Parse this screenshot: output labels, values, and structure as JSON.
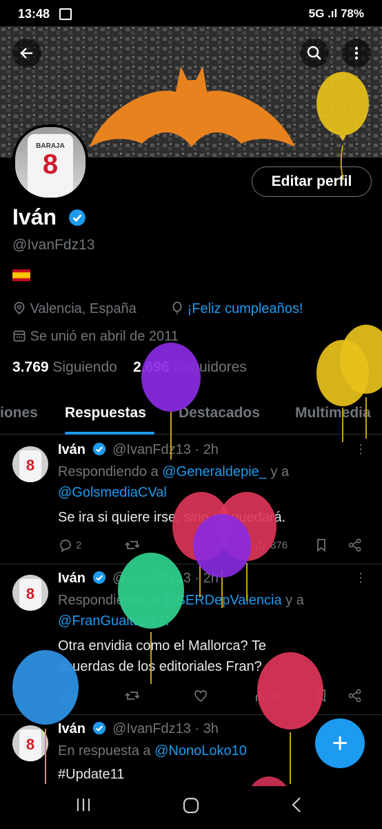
{
  "status_bar": {
    "time": "13:48",
    "right": "5G .ıl 78%"
  },
  "header": {
    "back_icon": "arrow-left-icon",
    "search_icon": "search-icon",
    "more_icon": "more-vertical-icon"
  },
  "profile": {
    "edit_label": "Editar perfil",
    "name": "Iván",
    "handle": "@IvanFdz13",
    "location": "Valencia, España",
    "birthday_text": "¡Feliz cumpleaños!",
    "joined": "Se unió en abril de 2011",
    "following_count": "3.769",
    "following_label": "Siguiendo",
    "followers_count": "2.696",
    "followers_label": "Seguidores",
    "avatar_shirt_text": "BARAJA",
    "avatar_shirt_number": "8"
  },
  "tabs": [
    "iones",
    "Respuestas",
    "Destacados",
    "Multimedia"
  ],
  "tweets": [
    {
      "name": "Iván",
      "handle": "@IvanFdz13 · 2h",
      "reply_prefix": "Respondiendo a",
      "reply_to_1": "@Generaldepie_",
      "reply_and": "y a",
      "reply_to_2": "@GolsmediaCVal",
      "text": "Se ira si quiere irse, sino se quedará.",
      "replies": "2",
      "views": "876"
    },
    {
      "name": "Iván",
      "handle": "@IvanFdz13 · 2h",
      "reply_prefix": "Respondiendo a",
      "reply_to_1": "@SERDepValencia",
      "reply_and": "y a",
      "reply_to_2": "@FranGuaitaSER",
      "text_line1": "Otra envidia como el Mallorca? Te",
      "text_line2": "acuerdas de los editoriales Fran?",
      "views": "35"
    },
    {
      "name": "Iván",
      "handle": "@IvanFdz13 · 3h",
      "reply_prefix": "En respuesta a",
      "reply_to_1": "@NonoLoko10",
      "text": "#Update11"
    }
  ],
  "fab_label": "+",
  "colors": {
    "accent": "#1d9bf0",
    "banner_bat": "#e8821f",
    "balloon_yellow": "#e8c21a",
    "balloon_purple": "#8a2be2",
    "balloon_pink": "#e0365a",
    "balloon_green": "#2ecc8a",
    "balloon_blue": "#2d8fe0"
  }
}
